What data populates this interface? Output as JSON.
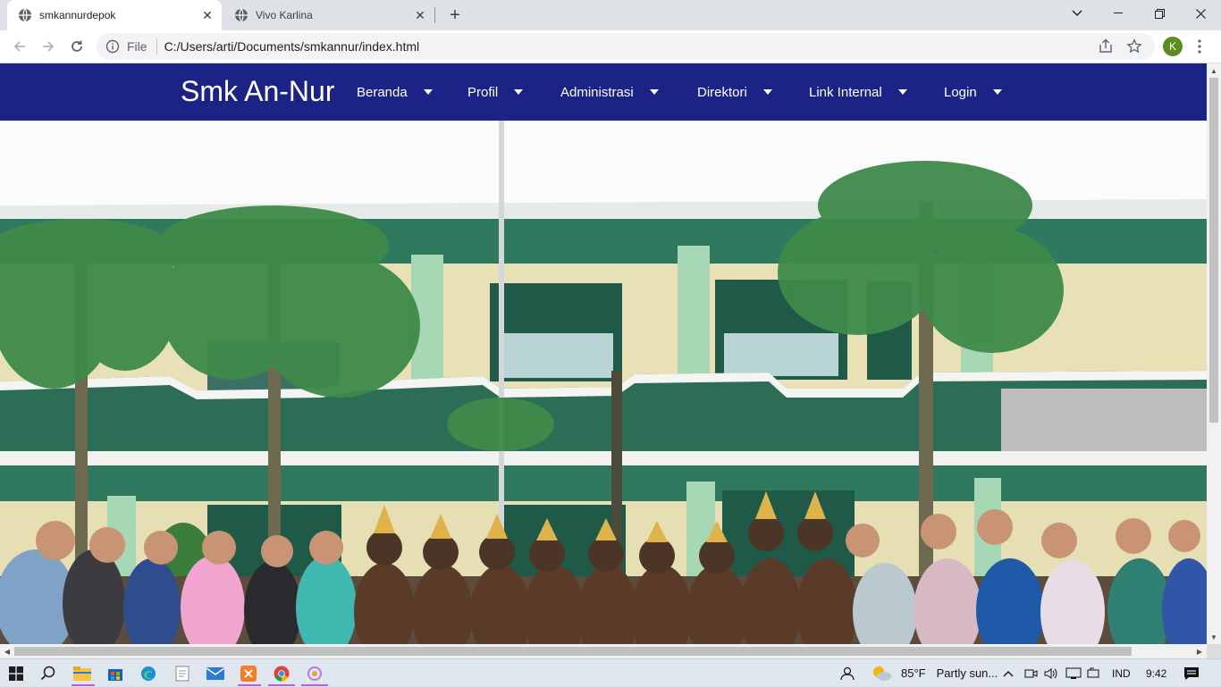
{
  "browser": {
    "tabs": [
      {
        "title": "smkannurdepok",
        "active": true
      },
      {
        "title": "Vivo Karlina",
        "active": false
      }
    ],
    "address": {
      "scheme": "File",
      "url": "C:/Users/arti/Documents/smkannur/index.html"
    },
    "profile_initial": "K"
  },
  "site": {
    "brand": "Smk An-Nur",
    "menu": [
      {
        "label": "Beranda"
      },
      {
        "label": "Profil"
      },
      {
        "label": "Administrasi"
      },
      {
        "label": "Direktori"
      },
      {
        "label": "Link Internal"
      },
      {
        "label": "Login"
      }
    ],
    "nav_color": "#1b2386"
  },
  "taskbar": {
    "weather": {
      "temp": "85°F",
      "condition": "Partly sun..."
    },
    "language": "IND",
    "time": "9:42"
  }
}
